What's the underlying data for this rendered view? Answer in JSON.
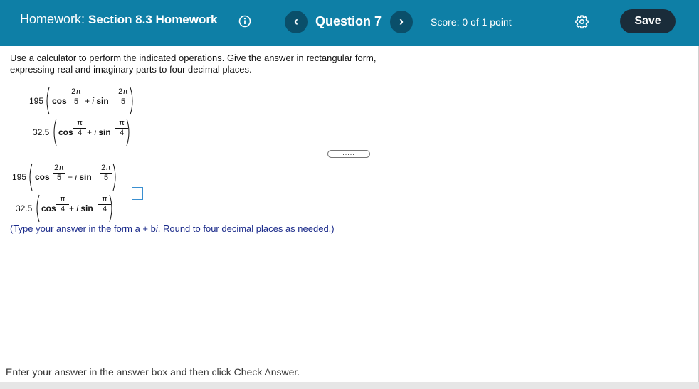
{
  "header": {
    "homework_prefix": "Homework:",
    "homework_title": "Section 8.3 Homework",
    "question_label": "Question 7",
    "score": "Score: 0 of 1 point",
    "save_label": "Save",
    "prev_label": "‹",
    "next_label": "›"
  },
  "instructions": "Use a calculator to perform the indicated operations. Give the answer in rectangular form, expressing real and imaginary parts to four decimal places.",
  "expression": {
    "num_coef": "195",
    "num_frac_top": "2π",
    "num_frac_bottom": "5",
    "den_coef": "32.5",
    "den_frac_top": "π",
    "den_frac_bottom": "4",
    "cos": "cos",
    "sin": "sin",
    "plus": "+",
    "i": "i",
    "equals": "="
  },
  "expander_label": ".....",
  "hint": {
    "pre": "(Type your answer in the form a + b",
    "i": "i",
    "post": ". Round to four decimal places as needed.)"
  },
  "footer": "Enter your answer in the answer box and then click Check Answer.",
  "colors": {
    "header_bg": "#0e7fa6",
    "save_bg": "#1a2c3a",
    "hint": "#1a2a8a"
  }
}
